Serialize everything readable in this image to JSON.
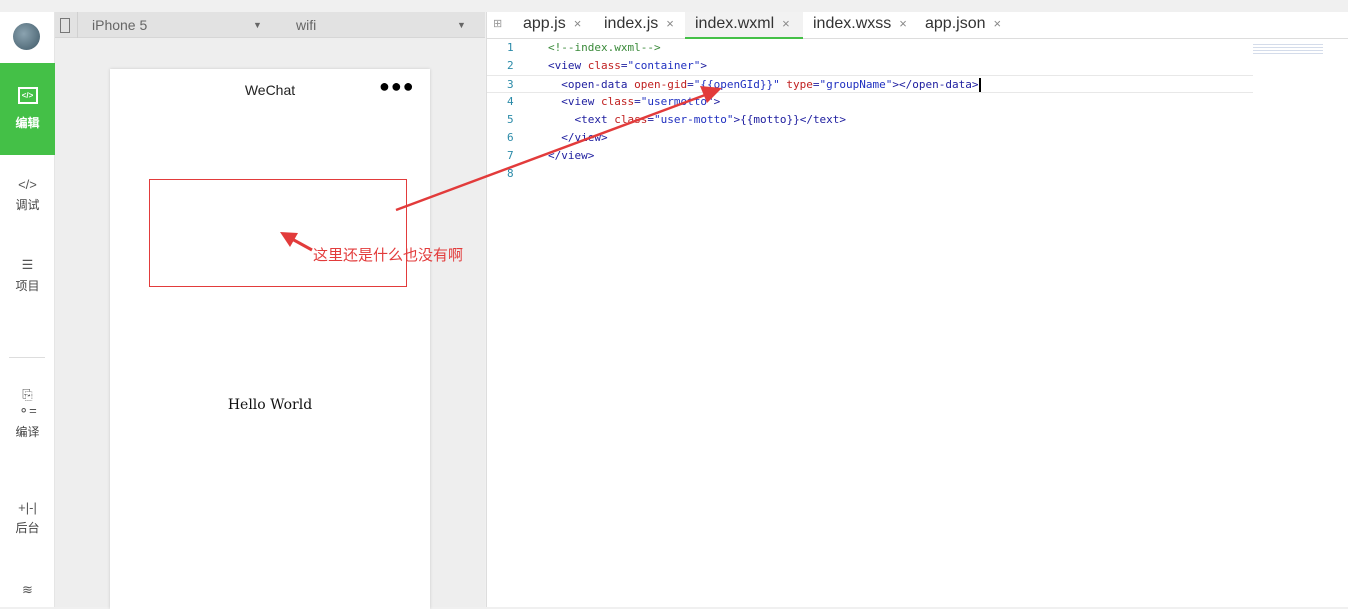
{
  "sidebar": {
    "items": [
      {
        "label": "编辑",
        "icon": "code-icon",
        "active": true
      },
      {
        "label": "调试",
        "icon": "debug-icon"
      },
      {
        "label": "项目",
        "icon": "menu-icon"
      },
      {
        "label": "编译",
        "icon": "compile-icon"
      },
      {
        "label": "后台",
        "icon": "backend-icon"
      },
      {
        "icon": "layers-icon"
      }
    ]
  },
  "simulator": {
    "device": "iPhone 5",
    "network": "wifi",
    "nav_title": "WeChat",
    "more": "●●●",
    "content": "Hello World"
  },
  "editor": {
    "tabs": [
      {
        "label": "app.js"
      },
      {
        "label": "index.js"
      },
      {
        "label": "index.wxml",
        "active": true
      },
      {
        "label": "index.wxss"
      },
      {
        "label": "app.json"
      }
    ],
    "close": "×",
    "lines": [
      {
        "n": "1",
        "text": "<!--index.wxml-->"
      },
      {
        "n": "2",
        "text": "<view class=\"container\">"
      },
      {
        "n": "3",
        "text": "  <open-data open-gid=\"{{openGId}}\" type=\"groupName\"></open-data>"
      },
      {
        "n": "4",
        "text": "  <view class=\"usermotto\">"
      },
      {
        "n": "5",
        "text": "    <text class=\"user-motto\">{{motto}}</text>"
      },
      {
        "n": "6",
        "text": "  </view>"
      },
      {
        "n": "7",
        "text": "</view>"
      },
      {
        "n": "8",
        "text": ""
      }
    ]
  },
  "annotation": {
    "text": "这里还是什么也没有啊",
    "color": "#e23b3b"
  },
  "colors": {
    "accent": "#44c047"
  }
}
